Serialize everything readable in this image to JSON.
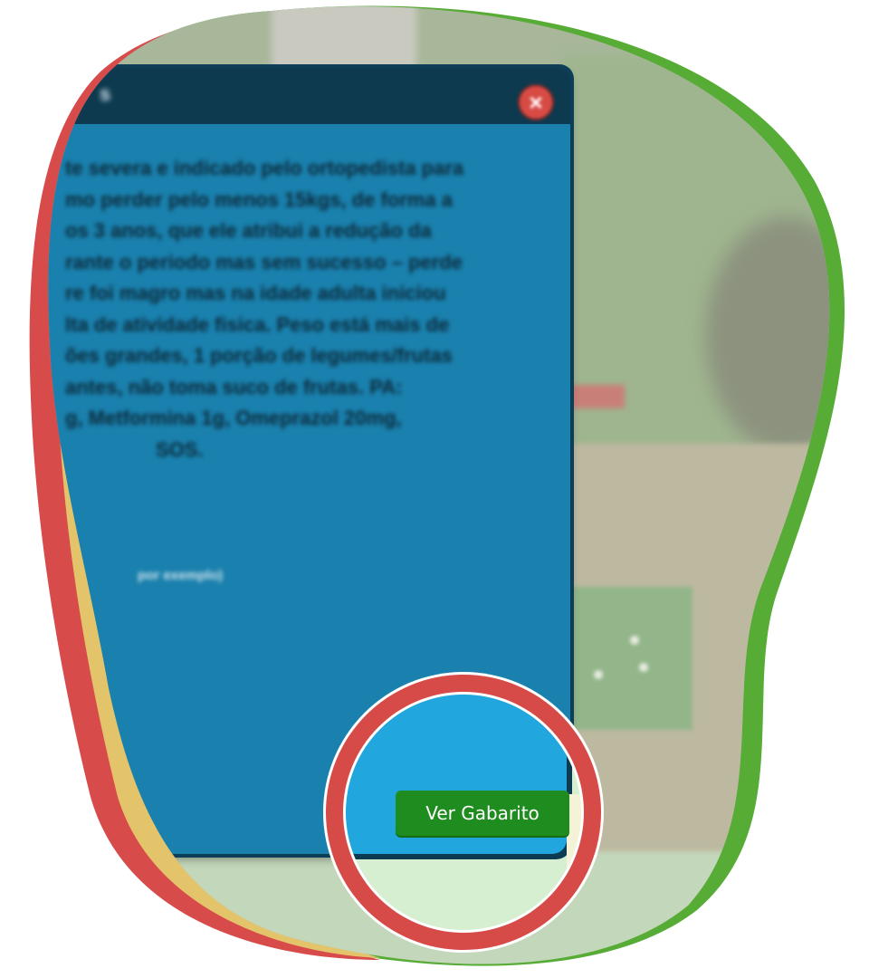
{
  "colors": {
    "modal_header": "#0e3a4f",
    "modal_body": "#1a80ad",
    "close_button": "#d84b45",
    "primary_button": "#1e8c1f",
    "frame_red": "#d84b4b",
    "frame_yellow": "#e3c46b",
    "frame_green": "#57ac35"
  },
  "modal": {
    "title": "s",
    "close_icon": "×",
    "body_lines": [
      "te severa e indicado pelo ortopedista para",
      "mo perder pelo menos 15kgs, de forma a",
      "os 3 anos, que ele atribui a redução da",
      "rante o periodo mas sem sucesso – perde",
      "re foi magro mas na idade adulta iniciou",
      "lta de atividade fisica. Peso está mais de",
      "ões grandes, 1 porção de legumes/frutas",
      "antes, não toma suco de frutas. PA:",
      "g, Metformina 1g, Omeprazol 20mg,",
      "SOS."
    ],
    "hint": "por exemplo)"
  },
  "button": {
    "ver_gabarito": "Ver Gabarito"
  },
  "icons": {
    "close": "close-icon",
    "focus": "magnifier-focus-circle"
  }
}
